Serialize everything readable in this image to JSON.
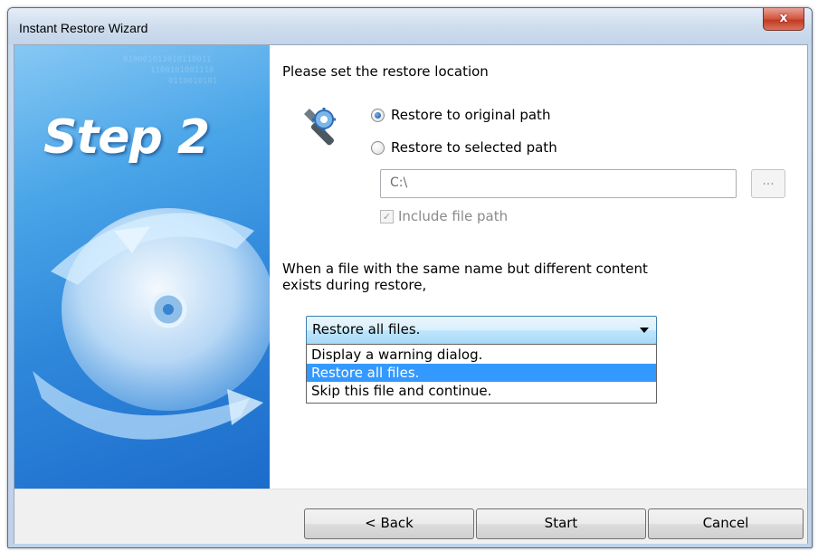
{
  "window": {
    "title": "Instant Restore Wizard",
    "close_glyph": "x"
  },
  "banner": {
    "step_label": "Step 2"
  },
  "content": {
    "heading": "Please set the restore location",
    "icon": "settings-wrench-icon",
    "radio_original": {
      "label": "Restore to original path",
      "selected": true
    },
    "radio_selected": {
      "label": "Restore to selected path",
      "selected": false
    },
    "path_field": {
      "value": "C:\\",
      "enabled": false
    },
    "browse_label": "...",
    "include_path": {
      "label": "Include file path",
      "checked": true,
      "enabled": false
    },
    "conflict_text_line1": "When a file with the same name but different content",
    "conflict_text_line2": "exists during restore,",
    "conflict_select": {
      "selected": "Restore all files.",
      "options": [
        "Display a warning dialog.",
        "Restore all files.",
        "Skip this file and continue."
      ],
      "highlighted_index": 1
    }
  },
  "footer": {
    "back_label": "< Back",
    "start_label": "Start",
    "cancel_label": "Cancel"
  },
  "colors": {
    "banner_blue": "#2f87da",
    "selection": "#3399ff",
    "close_red": "#c13a22"
  }
}
